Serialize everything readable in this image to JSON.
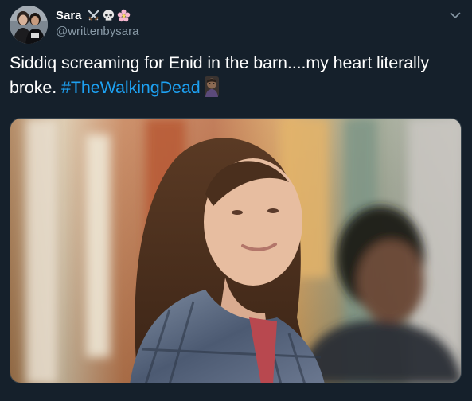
{
  "user": {
    "display_name": "Sara",
    "name_emojis": [
      "crossed-swords-icon",
      "skull-icon",
      "cherry-blossom-icon"
    ],
    "handle": "@writtenbysara",
    "avatar": "profile-avatar-photo"
  },
  "tweet": {
    "text_line1": "Siddiq screaming for Enid in the barn....my heart literally",
    "text_line2": "broke. ",
    "hashtag": "#TheWalkingDead",
    "trailing_emoji": "zombie-icon"
  },
  "menu": {
    "icon": "chevron-down-icon"
  },
  "media": {
    "description_icon": "photo-two-people-outdoors"
  },
  "colors": {
    "background": "#15202b",
    "text": "#ffffff",
    "secondary_text": "#8899a6",
    "link": "#1da1f2",
    "border": "#38444d"
  }
}
